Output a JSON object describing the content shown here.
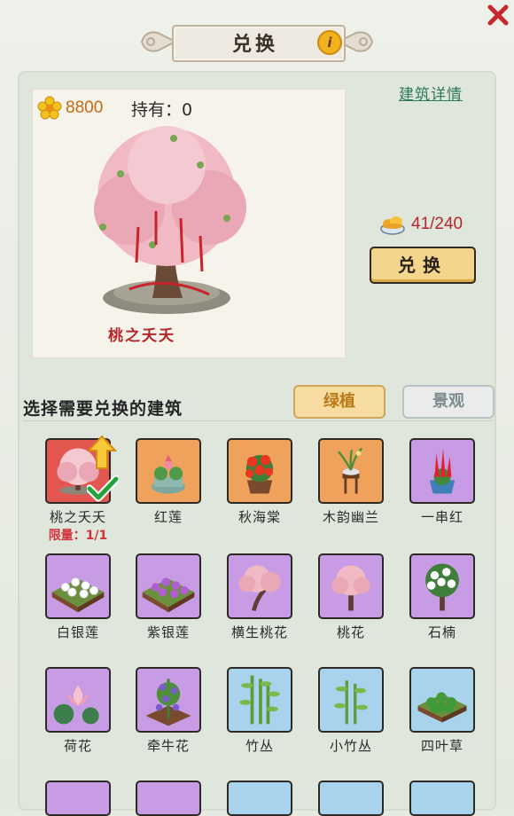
{
  "header": {
    "title": "兑换",
    "info_icon": "info-icon",
    "info_label": "i",
    "close_icon": "close-icon"
  },
  "display": {
    "currency_icon": "flower-coin-icon",
    "currency_value": "8800",
    "holding_label": "持有：0",
    "building_name": "桃之夭夭",
    "detail_link": "建筑详情",
    "cost_icon": "gold-ingot-bowl-icon",
    "cost_value": "41/240",
    "exchange_button": "兑换"
  },
  "select": {
    "title": "选择需要兑换的建筑",
    "filter_selected": "绿植",
    "filter_other": "景观"
  },
  "items": [
    {
      "label": "桃之夭夭",
      "limit": "限量：1/1"
    },
    {
      "label": "红莲"
    },
    {
      "label": "秋海棠"
    },
    {
      "label": "木韵幽兰"
    },
    {
      "label": "一串红"
    },
    {
      "label": "白银莲"
    },
    {
      "label": "紫银莲"
    },
    {
      "label": "横生桃花"
    },
    {
      "label": "桃花"
    },
    {
      "label": "石楠"
    },
    {
      "label": "荷花"
    },
    {
      "label": "牵牛花"
    },
    {
      "label": "竹丛"
    },
    {
      "label": "小竹丛"
    },
    {
      "label": "四叶草"
    }
  ],
  "colors": {
    "accent_red": "#b3272b",
    "currency_orange": "#c66a14",
    "link_green": "#2f7a5a",
    "button_yellow": "#f3d58b"
  }
}
